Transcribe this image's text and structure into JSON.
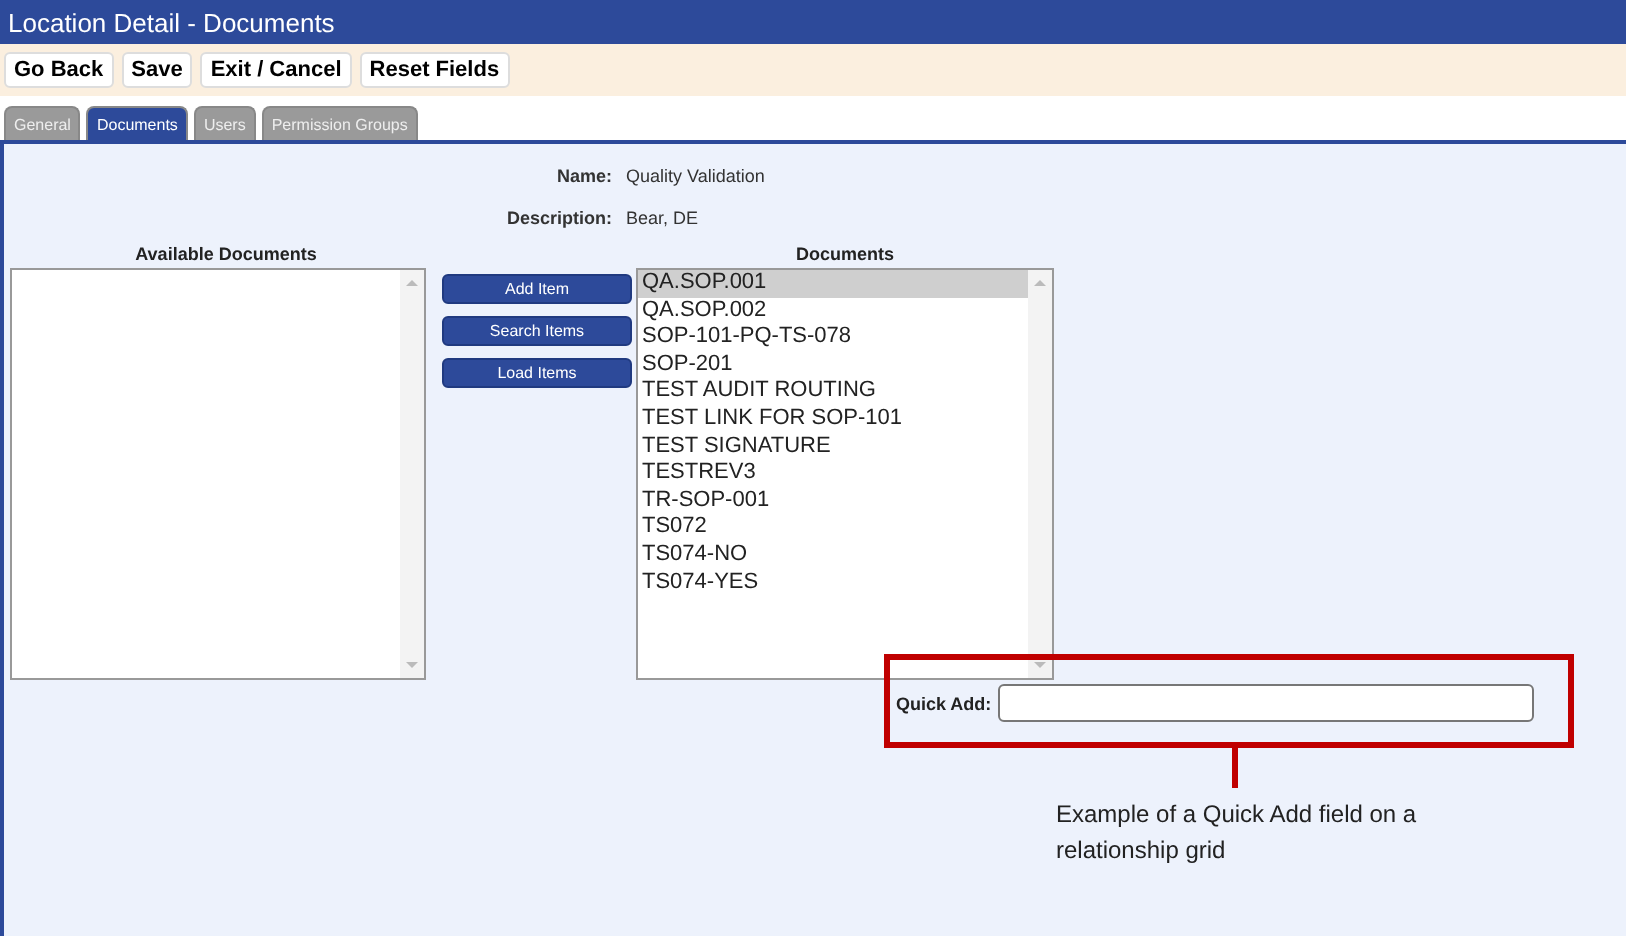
{
  "window": {
    "title": "Location Detail - Documents"
  },
  "toolbar": [
    "Go Back",
    "Save",
    "Exit / Cancel",
    "Reset Fields"
  ],
  "tabs": [
    {
      "label": "General",
      "selected": false
    },
    {
      "label": "Documents",
      "selected": true
    },
    {
      "label": "Users",
      "selected": false
    },
    {
      "label": "Permission Groups",
      "selected": false
    }
  ],
  "fields": [
    {
      "label": "Name:",
      "value": "Quality Validation"
    },
    {
      "label": "Description:",
      "value": "Bear, DE"
    }
  ],
  "available_documents": {
    "heading": "Available Documents"
  },
  "actions": [
    "Add Item",
    "Search Items",
    "Load Items"
  ],
  "documents": {
    "heading": "Documents",
    "items": [
      {
        "label": "QA.SOP.001",
        "selected": true
      },
      {
        "label": "QA.SOP.002",
        "selected": false
      },
      {
        "label": "SOP-101-PQ-TS-078",
        "selected": false
      },
      {
        "label": "SOP-201",
        "selected": false
      },
      {
        "label": "TEST AUDIT ROUTING",
        "selected": false
      },
      {
        "label": "TEST LINK FOR SOP-101",
        "selected": false
      },
      {
        "label": "TEST SIGNATURE",
        "selected": false
      },
      {
        "label": "TESTREV3",
        "selected": false
      },
      {
        "label": "TR-SOP-001",
        "selected": false
      },
      {
        "label": "TS072",
        "selected": false
      },
      {
        "label": "TS074-NO",
        "selected": false
      },
      {
        "label": "TS074-YES",
        "selected": false
      }
    ]
  },
  "quick_add": {
    "label": "Quick Add:"
  },
  "annotation": {
    "caption": "Example of a Quick Add field on a relationship grid"
  }
}
